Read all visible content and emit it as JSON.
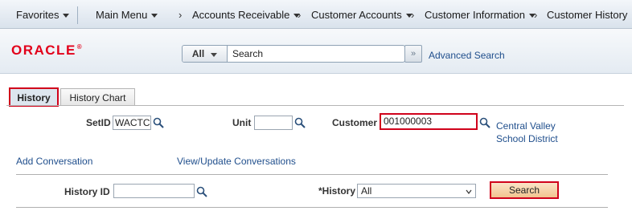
{
  "nav": {
    "favorites": "Favorites",
    "main_menu": "Main Menu",
    "crumbs": [
      "Accounts Receivable",
      "Customer Accounts",
      "Customer Information",
      "Customer History"
    ]
  },
  "header": {
    "logo": "ORACLE",
    "logo_mark": "®",
    "search_scope": "All",
    "search_value": "Search",
    "advanced_search": "Advanced Search"
  },
  "tabs": [
    {
      "label": "History",
      "active": true
    },
    {
      "label": "History Chart",
      "active": false
    }
  ],
  "form": {
    "setid_label": "SetID",
    "setid_value": "WACTC",
    "unit_label": "Unit",
    "unit_value": "",
    "customer_label": "Customer",
    "customer_value": "001000003",
    "customer_desc": "Central Valley School District",
    "add_conversation": "Add Conversation",
    "view_update": "View/Update Conversations",
    "history_id_label": "History ID",
    "history_id_value": "",
    "history_label": "*History",
    "history_value": "All",
    "search_button": "Search"
  },
  "colors": {
    "highlight": "#d0021b",
    "link": "#1f4e8c",
    "logo": "#e2001a"
  }
}
